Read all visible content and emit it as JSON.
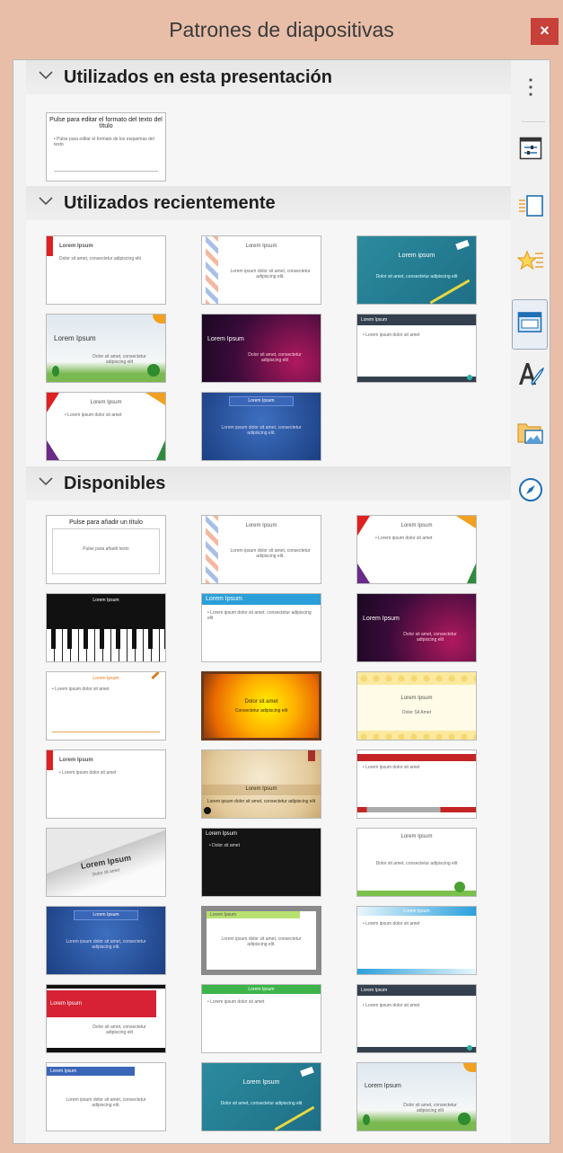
{
  "window": {
    "title": "Patrones de diapositivas",
    "close_glyph": "×"
  },
  "sections": {
    "used": {
      "label": "Utilizados en esta presentación"
    },
    "recent": {
      "label": "Utilizados recientemente"
    },
    "available": {
      "label": "Disponibles"
    }
  },
  "thumbs": {
    "used_1": {
      "title": "Pulse para editar el formato del texto del título",
      "body": "• Pulse para editar el formato de los esquemas del texto"
    },
    "r1": {
      "title": "Lorem Ipsum",
      "body": "Dolor sit amet, consectetur adipiscing elit"
    },
    "r2": {
      "title": "Lorem Ipsum",
      "body": "Lorem ipsum dolor sit amet, consectetur adipiscing elit."
    },
    "r3": {
      "title": "Lorem ipsum",
      "body": "Dolor sit amet, consectetur adipiscing elit"
    },
    "r4": {
      "title": "Lorem Ipsum",
      "body": "Dolor sit amet, consectetur adipiscing elit"
    },
    "r5": {
      "title": "Lorem Ipsum",
      "body": "Dolor sit amet, consectetur adipiscing elit"
    },
    "r6": {
      "title": "Lorem Ipsum",
      "body": "• Lorem ipsum dolor sit amet"
    },
    "r7": {
      "title": "Lorem Ipsum",
      "body": "• Lorem ipsum dolor sit amet"
    },
    "r8": {
      "title": "Lorem Ipsum",
      "body": "Lorem ipsum dolor sit amet, consectetur adipiscing elit."
    },
    "a1": {
      "title": "Pulse para añadir un título",
      "body": "Pulse para añadir texto"
    },
    "a2": {
      "title": "Lorem Ipsum",
      "body": "Lorem ipsum dolor sit amet, consectetur adipiscing elit."
    },
    "a3": {
      "title": "Lorem Ipsum",
      "body": "• Lorem ipsum dolor sit amet"
    },
    "a4": {
      "title": "Lorem Ipsum",
      "body": ""
    },
    "a5": {
      "title": "Lorem Ipsum",
      "body": "• Lorem ipsum dolor sit amet, consectetur adipiscing elit"
    },
    "a6": {
      "title": "Lorem Ipsum",
      "body": "Dolor sit amet, consectetur adipiscing elit"
    },
    "a7": {
      "title": "Lorem Ipsum",
      "body": "• Lorem ipsum dolor sit amet"
    },
    "a8": {
      "title": "Dolor sit amet",
      "body": "Consectetur adipiscing elit"
    },
    "a9": {
      "title": "Lorem Ipsum",
      "body": "Dolor Sit Amet"
    },
    "a10": {
      "title": "Lorem Ipsum",
      "body": "• Lorem ipsum dolor sit amet"
    },
    "a11": {
      "title": "Lorem Ipsum",
      "body": "Lorem ipsum dolor sit amet, consectetur adipiscing elit"
    },
    "a12": {
      "title": "",
      "body": "• Lorem ipsum dolor sit amet"
    },
    "a13": {
      "title": "Lorem Ipsum",
      "body": "Dolor sit amet"
    },
    "a14": {
      "title": "Lorem Ipsum",
      "body": "• Dolor sit amet"
    },
    "a15": {
      "title": "Lorem Ipsum",
      "body": "Dolor sit amet, consectetur adipiscing elit"
    },
    "a16": {
      "title": "Lorem Ipsum",
      "body": "Lorem ipsum dolor sit amet, consectetur adipiscing elit."
    },
    "a17": {
      "title": "Lorem Ipsum",
      "body": "Lorem ipsum dolor sit amet, consectetur adipiscing elit."
    },
    "a18": {
      "title": "Lorem Ipsum",
      "body": "• Lorem ipsum dolor sit amet"
    },
    "a19": {
      "title": "Lorem Ipsum",
      "body": "Dolor sit amet, consectetur adipiscing elit"
    },
    "a20": {
      "title": "Lorem Ipsum",
      "body": "• Lorem ipsum dolor sit amet"
    },
    "a21": {
      "title": "Lorem Ipsum",
      "body": "• Lorem ipsum dolor sit amet"
    },
    "a22": {
      "title": "Lorem Ipsum",
      "body": "Lorem ipsum dolor sit amet, consectetur adipiscing elit."
    },
    "a23": {
      "title": "Lorem Ipsum",
      "body": "Dolor sit amet, consectetur adipiscing elit"
    },
    "a24": {
      "title": "Lorem Ipsum",
      "body": "Dolor sit amet, consectetur adipiscing elit"
    }
  },
  "sidebar": {
    "buttons": [
      {
        "icon": "more-options-icon"
      },
      {
        "icon": "properties-icon"
      },
      {
        "icon": "slide-transition-icon"
      },
      {
        "icon": "animation-icon"
      },
      {
        "icon": "master-slides-icon",
        "active": true
      },
      {
        "icon": "styles-icon"
      },
      {
        "icon": "gallery-icon"
      },
      {
        "icon": "navigator-icon"
      }
    ]
  }
}
